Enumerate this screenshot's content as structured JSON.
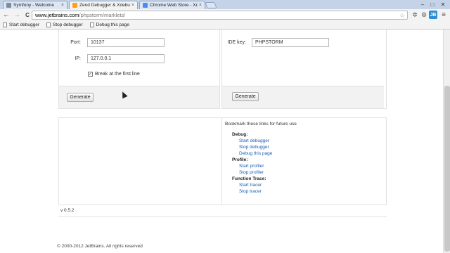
{
  "tabs": [
    {
      "label": "Symfony - Welcome",
      "favicon_color": "#7e8c9a"
    },
    {
      "label": "Zend Debugger & Xdebug",
      "favicon_color": "#ff9f1a"
    },
    {
      "label": "Chrome Web Store - Xdeb",
      "favicon_color": "#4a8af4"
    }
  ],
  "tab_close": "×",
  "window_controls": {
    "minimize": "–",
    "maximize": "□",
    "close": "✕"
  },
  "toolbar": {
    "back": "←",
    "forward": "→",
    "reload": "C",
    "url_domain": "www.jetbrains.com",
    "url_path": "/phpstorm/marklets/",
    "star": "☆",
    "jb_badge": "JB",
    "wrench": "≡"
  },
  "bookmarks": [
    "Start debugger",
    "Stop debugger",
    "Debug this page"
  ],
  "form": {
    "port_label": "Port:",
    "port_value": "10137",
    "ip_label": "IP:",
    "ip_value": "127.0.0.1",
    "break_checked": "✓",
    "break_label": "Break at the first line",
    "generate_left": "Generate",
    "idekey_label": "IDE key:",
    "idekey_value": "PHPSTORM",
    "generate_right": "Generate"
  },
  "bookmarks_panel": {
    "intro": "Bookmark these links for future use",
    "groups": [
      {
        "title": "Debug:",
        "links": [
          "Start debugger",
          "Stop debugger",
          "Debug this page"
        ]
      },
      {
        "title": "Profile:",
        "links": [
          "Start profiler",
          "Stop profiler"
        ]
      },
      {
        "title": "Function Trace:",
        "links": [
          "Start tracer",
          "Stop tracer"
        ]
      }
    ]
  },
  "version": "v 0.5.2",
  "footer": "© 2000-2012 JetBrains. All rights reserved"
}
